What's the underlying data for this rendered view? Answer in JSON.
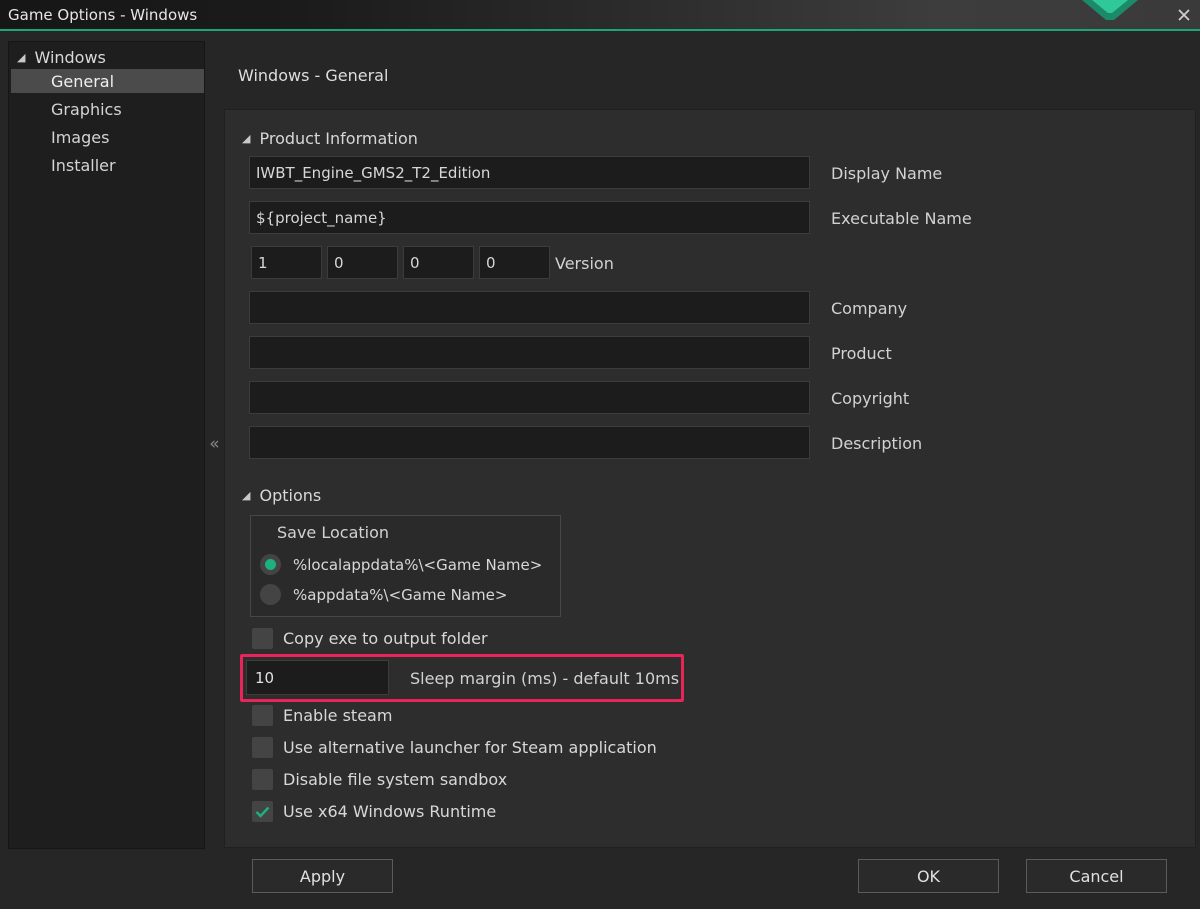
{
  "window": {
    "title": "Game Options - Windows",
    "accent_color": "#1fa37a"
  },
  "tree": {
    "root": "Windows",
    "items": [
      {
        "label": "General",
        "selected": true
      },
      {
        "label": "Graphics",
        "selected": false
      },
      {
        "label": "Images",
        "selected": false
      },
      {
        "label": "Installer",
        "selected": false
      }
    ],
    "collapse_glyph": "«"
  },
  "page_title": "Windows - General",
  "product_info": {
    "header": "Product Information",
    "display_name": {
      "value": "IWBT_Engine_GMS2_T2_Edition",
      "label": "Display Name"
    },
    "executable_name": {
      "value": "${project_name}",
      "label": "Executable Name"
    },
    "version": {
      "major": "1",
      "minor": "0",
      "build": "0",
      "revision": "0",
      "label": "Version"
    },
    "company": {
      "value": "",
      "label": "Company"
    },
    "product": {
      "value": "",
      "label": "Product"
    },
    "copyright": {
      "value": "",
      "label": "Copyright"
    },
    "description": {
      "value": "",
      "label": "Description"
    }
  },
  "options": {
    "header": "Options",
    "save_location": {
      "title": "Save Location",
      "choices": [
        {
          "label": "%localappdata%\\<Game Name>",
          "selected": true
        },
        {
          "label": "%appdata%\\<Game Name>",
          "selected": false
        }
      ]
    },
    "copy_exe": {
      "label": "Copy exe to output folder",
      "checked": false
    },
    "sleep_margin": {
      "value": "10",
      "label": "Sleep margin (ms) - default 10ms"
    },
    "enable_steam": {
      "label": "Enable steam",
      "checked": false
    },
    "alt_launcher": {
      "label": "Use alternative launcher for Steam application",
      "checked": false
    },
    "disable_sandbox": {
      "label": "Disable file system sandbox",
      "checked": false
    },
    "x64_runtime": {
      "label": "Use x64 Windows Runtime",
      "checked": true
    }
  },
  "buttons": {
    "apply": "Apply",
    "ok": "OK",
    "cancel": "Cancel"
  },
  "icons": {
    "close": "close-icon",
    "collapse": "double-chevron-left-icon",
    "tree_arrow": "triangle-down-icon",
    "check": "checkmark-icon"
  },
  "colors": {
    "highlight": "#e8245a",
    "check": "#1cb27f",
    "selected_item": "#4b4b4b"
  }
}
